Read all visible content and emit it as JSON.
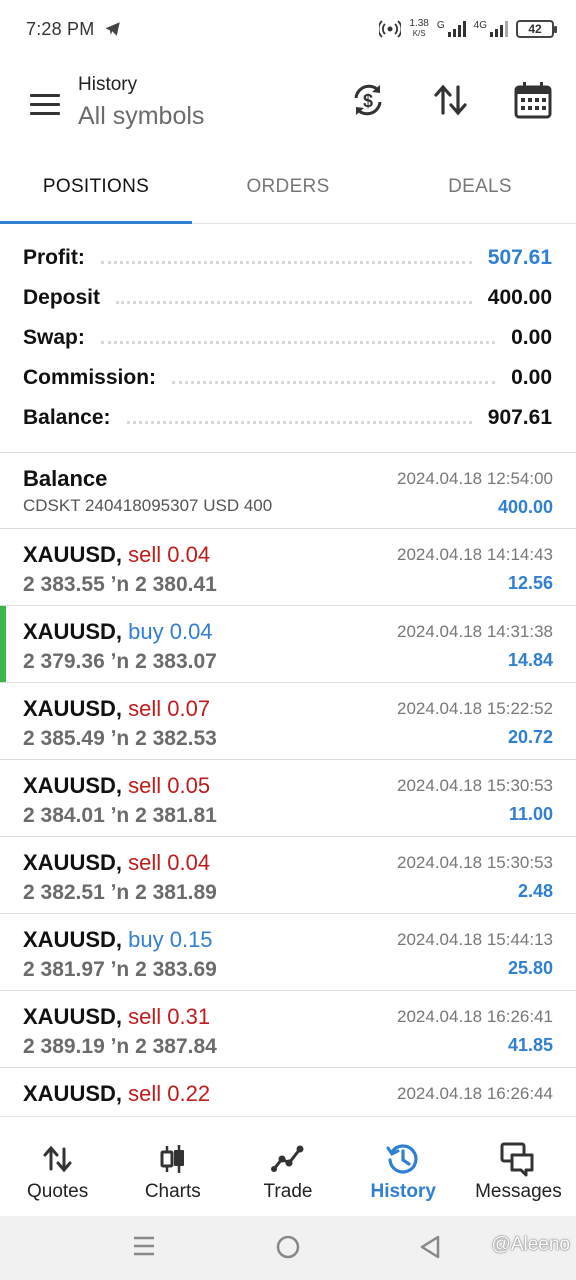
{
  "status_bar": {
    "time": "7:28 PM",
    "speed_value": "1.38",
    "speed_unit": "K/S",
    "sig1_tag": "G",
    "sig2_tag": "4G",
    "battery": "42"
  },
  "header": {
    "title": "History",
    "subtitle": "All symbols"
  },
  "tabs": [
    "POSITIONS",
    "ORDERS",
    "DEALS"
  ],
  "summary": [
    {
      "label": "Profit:",
      "value": "507.61"
    },
    {
      "label": "Deposit",
      "value": "400.00"
    },
    {
      "label": "Swap:",
      "value": "0.00"
    },
    {
      "label": "Commission:",
      "value": "0.00"
    },
    {
      "label": "Balance:",
      "value": "907.61"
    }
  ],
  "balance_entry": {
    "title": "Balance",
    "comment": "CDSKT 240418095307 USD 400",
    "time": "2024.04.18 12:54:00",
    "amount": "400.00"
  },
  "deals": [
    {
      "symbol": "XAUUSD,",
      "type": "sell 0.04",
      "prices": "2 383.55 ʼn  2 380.41",
      "time": "2024.04.18 14:14:43",
      "profit": "12.56"
    },
    {
      "symbol": "XAUUSD,",
      "type": "buy 0.04",
      "prices": "2 379.36 ʼn  2 383.07",
      "time": "2024.04.18 14:31:38",
      "profit": "14.84"
    },
    {
      "symbol": "XAUUSD,",
      "type": "sell 0.07",
      "prices": "2 385.49 ʼn  2 382.53",
      "time": "2024.04.18 15:22:52",
      "profit": "20.72"
    },
    {
      "symbol": "XAUUSD,",
      "type": "sell 0.05",
      "prices": "2 384.01 ʼn  2 381.81",
      "time": "2024.04.18 15:30:53",
      "profit": "11.00"
    },
    {
      "symbol": "XAUUSD,",
      "type": "sell 0.04",
      "prices": "2 382.51 ʼn  2 381.89",
      "time": "2024.04.18 15:30:53",
      "profit": "2.48"
    },
    {
      "symbol": "XAUUSD,",
      "type": "buy 0.15",
      "prices": "2 381.97 ʼn  2 383.69",
      "time": "2024.04.18 15:44:13",
      "profit": "25.80"
    },
    {
      "symbol": "XAUUSD,",
      "type": "sell 0.31",
      "prices": "2 389.19 ʼn  2 387.84",
      "time": "2024.04.18 16:26:41",
      "profit": "41.85"
    },
    {
      "symbol": "XAUUSD,",
      "type": "sell 0.22",
      "prices": "",
      "time": "2024.04.18 16:26:44",
      "profit": ""
    }
  ],
  "bottom_nav": [
    "Quotes",
    "Charts",
    "Trade",
    "History",
    "Messages"
  ],
  "watermark": "@Aleeno",
  "colors": {
    "accent_blue": "#2f7fd3",
    "sell_red": "#c11b1b",
    "selected_marker": "#3cb54a"
  }
}
